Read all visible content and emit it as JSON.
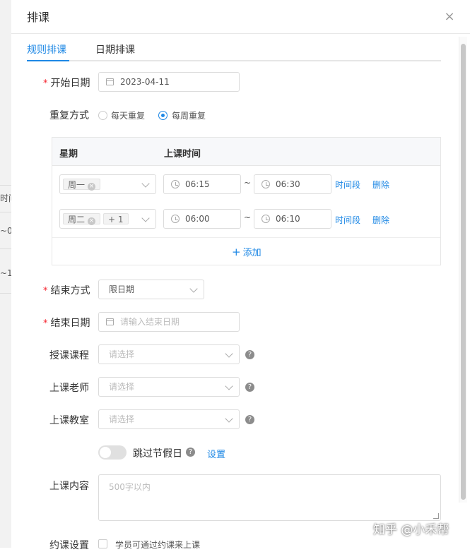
{
  "background": {
    "col_header": "时间",
    "row1": "~0",
    "row2": "~1"
  },
  "dialog": {
    "title": "排课"
  },
  "tabs": [
    {
      "label": "规则排课",
      "active": true
    },
    {
      "label": "日期排课",
      "active": false
    }
  ],
  "form": {
    "start_date": {
      "label": "开始日期",
      "value": "2023-04-11"
    },
    "repeat": {
      "label": "重复方式",
      "options": [
        {
          "label": "每天重复",
          "selected": false
        },
        {
          "label": "每周重复",
          "selected": true
        }
      ]
    },
    "schedule_table": {
      "headers": [
        "星期",
        "上课时间"
      ],
      "rows": [
        {
          "days": [
            "周一"
          ],
          "extra": "",
          "start": "06:15",
          "end": "06:30"
        },
        {
          "days": [
            "周二"
          ],
          "extra": "+ 1",
          "start": "06:00",
          "end": "06:10"
        }
      ],
      "tilde": "~",
      "time_slot_link": "时间段",
      "delete_link": "删除",
      "add_label": "添加",
      "add_icon": "+"
    },
    "end_mode": {
      "label": "结束方式",
      "value": "限日期"
    },
    "end_date": {
      "label": "结束日期",
      "placeholder": "请输入结束日期"
    },
    "course": {
      "label": "授课课程",
      "placeholder": "请选择"
    },
    "teacher": {
      "label": "上课老师",
      "placeholder": "请选择"
    },
    "classroom": {
      "label": "上课教室",
      "placeholder": "请选择"
    },
    "skip_holiday": {
      "label": "跳过节假日",
      "enabled": false,
      "settings_link": "设置"
    },
    "content": {
      "label": "上课内容",
      "placeholder": "500字以内"
    },
    "booking": {
      "label": "约课设置",
      "checkbox_label": "学员可通过约课来上课",
      "checked": false
    }
  },
  "required_mark": "*",
  "help_mark": "?",
  "close_mark": "×",
  "watermark": "知乎 @小禾帮",
  "colors": {
    "accent": "#1e88e5",
    "required": "#f5222d"
  }
}
